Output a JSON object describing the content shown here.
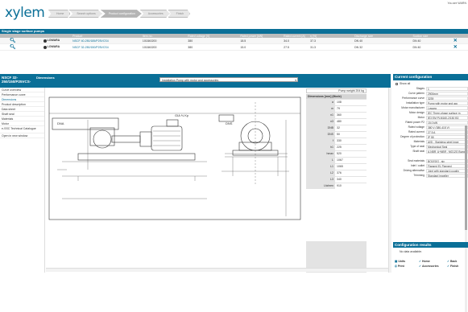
{
  "brand": {
    "logo": "xylem"
  },
  "steps": [
    "Home",
    "Search options",
    "Product configuration",
    "Accessories",
    "Finish"
  ],
  "header": {
    "welcome": "You are WARN"
  },
  "section": {
    "title": "Single stage surface pumps"
  },
  "results_table": {
    "columns": [
      "",
      "",
      "Product",
      "Item no.",
      "Rated voltage [V]",
      "Rated power [kW]",
      "Rated current [A]",
      "η [%]",
      "Discharge size",
      "Suction size",
      ""
    ],
    "rows": [
      {
        "brand": "LOWARA",
        "product": "NSCF 40-250/185/P25VCS4",
        "item": "101840200",
        "voltage": "380",
        "power": "18.5",
        "current": "34.0",
        "eta": "37.3",
        "discharge": "DN 40",
        "suction": "DN 40"
      },
      {
        "brand": "LOWARA",
        "product": "NSCF 32-250/150/P25VCS4",
        "item": "101840200",
        "voltage": "380",
        "power": "15.0",
        "current": "27.5",
        "eta": "31.3",
        "discharge": "DN 32",
        "suction": "DN 40"
      }
    ]
  },
  "dimensions": {
    "title_line1": "NSCF 32-",
    "title_line2": "250/150/P25VCS-",
    "label": "Dimensions",
    "select": "Installation Pump with motor and accessories",
    "weight": "Pump weight  204 kg",
    "table_title": "Dimensions [mm] (Mode)",
    "rows": [
      {
        "k": "a",
        "v": "108"
      },
      {
        "k": "m",
        "v": "79"
      },
      {
        "k": "n1",
        "v": "360"
      },
      {
        "k": "n3",
        "v": "480"
      },
      {
        "k": "DNB",
        "v": "32"
      },
      {
        "k": "DNS",
        "v": "50"
      },
      {
        "k": "f",
        "v": "330"
      },
      {
        "k": "h1",
        "v": "225"
      },
      {
        "k": "hmax",
        "v": "520"
      },
      {
        "k": "L",
        "v": "1067"
      },
      {
        "k": "L1",
        "v": "1065"
      },
      {
        "k": "L2",
        "v": "376"
      },
      {
        "k": "L3",
        "v": "340"
      },
      {
        "k": "Lfahren",
        "v": "910"
      }
    ]
  },
  "nav": [
    "Curve overview",
    "Performance curve",
    "Dimensions",
    "Product description",
    "Data sheet",
    "Shaft seal",
    "Materials",
    "Motor",
    "e-SSC Technical Catalogue",
    "Open in new window"
  ],
  "drawing": {
    "labels": [
      "DNA",
      "GIA ⅜ Kp",
      "DNS"
    ]
  },
  "config": {
    "title": "Current configuration",
    "show_all": "Show all",
    "rows": [
      {
        "k": "Stages",
        "v": "1"
      },
      {
        "k": "Curve pattern",
        "v": "2900rpm"
      },
      {
        "k": "Performance curve",
        "v": "3239"
      },
      {
        "k": "Installation type",
        "v": "Pump with motor and acc"
      },
      {
        "k": "Motor manufacturer",
        "v": "Lowara"
      },
      {
        "k": "Motor design",
        "v": "IEC Three-phase surface m"
      },
      {
        "k": "Motor",
        "v": "IE3 EM PLM160-2/150 B3"
      },
      {
        "k": "Rated power P2",
        "v": "15.0 kW"
      },
      {
        "k": "Rated voltage",
        "v": "380 V (380-415 V)"
      },
      {
        "k": "Rated current",
        "v": "27.5 A"
      },
      {
        "k": "Degree of protection",
        "v": "IP 55"
      },
      {
        "k": "Materials",
        "v": "AISI - Stainless steel impe"
      },
      {
        "k": "Type of seal",
        "v": "Mechanical Seal"
      },
      {
        "k": "Shaft seal",
        "v": "A-NBR, A+NBR - MG12G Burgmann"
      },
      {
        "k": "",
        "v": ""
      },
      {
        "k": "Seal materials",
        "v": "BQ1EGG - sic"
      },
      {
        "k": "Inlet / outlet",
        "v": "Flanged EL Flanged"
      },
      {
        "k": "Driving alternative",
        "v": "Joint with standard couplin"
      },
      {
        "k": "Trimming",
        "v": "Standard impeller"
      }
    ]
  },
  "results": {
    "title": "Configuration results",
    "nodata": "No data available.",
    "actions": [
      {
        "icon": "▦",
        "label": "Units"
      },
      {
        "icon": "✓",
        "label": "Home"
      },
      {
        "icon": "✓",
        "label": "Back"
      },
      {
        "icon": "⎙",
        "label": "Print"
      },
      {
        "icon": "✓",
        "label": "Accessories"
      },
      {
        "icon": "✓",
        "label": "Finish"
      }
    ]
  }
}
